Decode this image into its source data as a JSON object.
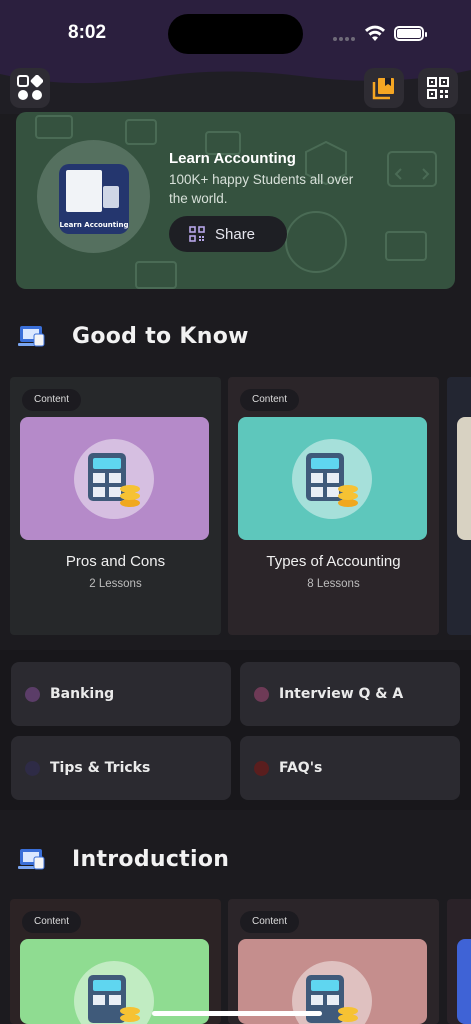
{
  "status_bar": {
    "time": "8:02"
  },
  "banner": {
    "title": "Learn Accounting",
    "subtitle": "100K+ happy Students all over the world.",
    "book_label": "Learn Accounting",
    "share_label": "Share",
    "color": "#35523f"
  },
  "sections": [
    {
      "title": "Good to Know",
      "cards": [
        {
          "tag": "Content",
          "title": "Pros and Cons",
          "sub": "2 Lessons",
          "thumb_color": "#b58ac9",
          "card_color": "#26282a"
        },
        {
          "tag": "Content",
          "title": "Types of Accounting",
          "sub": "8 Lessons",
          "thumb_color": "#5ec7bc",
          "card_color": "#2b2529"
        }
      ]
    },
    {
      "title": "Introduction",
      "cards": [
        {
          "tag": "Content",
          "title": "",
          "sub": "",
          "thumb_color": "#8fdc91",
          "card_color": "#2c2325"
        },
        {
          "tag": "Content",
          "title": "",
          "sub": "",
          "thumb_color": "#c58e8d",
          "card_color": "#2b2529"
        }
      ]
    }
  ],
  "quick_links": [
    {
      "label": "Banking",
      "dot_color": "#5b3d68"
    },
    {
      "label": "Interview Q & A",
      "dot_color": "#6e3a56"
    },
    {
      "label": "Tips & Tricks",
      "dot_color": "#2e2b46"
    },
    {
      "label": "FAQ's",
      "dot_color": "#5a1e1e"
    }
  ]
}
